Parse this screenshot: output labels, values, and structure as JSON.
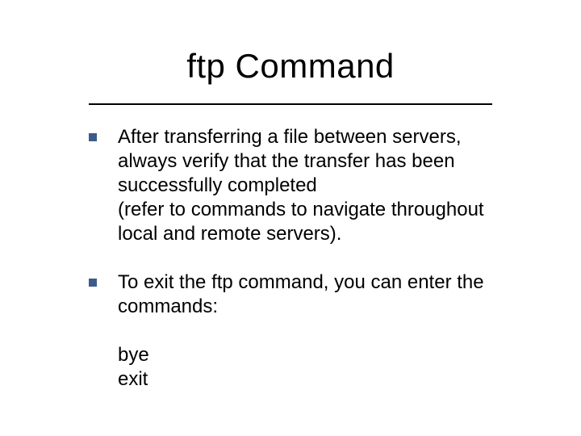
{
  "title": "ftp Command",
  "bullets": [
    {
      "text": "After transferring a file between servers, always verify that the transfer has been successfully completed\n(refer to commands to navigate throughout local and remote servers)."
    },
    {
      "text": "To exit the ftp command, you can enter the commands:"
    }
  ],
  "commands": "bye\nexit"
}
